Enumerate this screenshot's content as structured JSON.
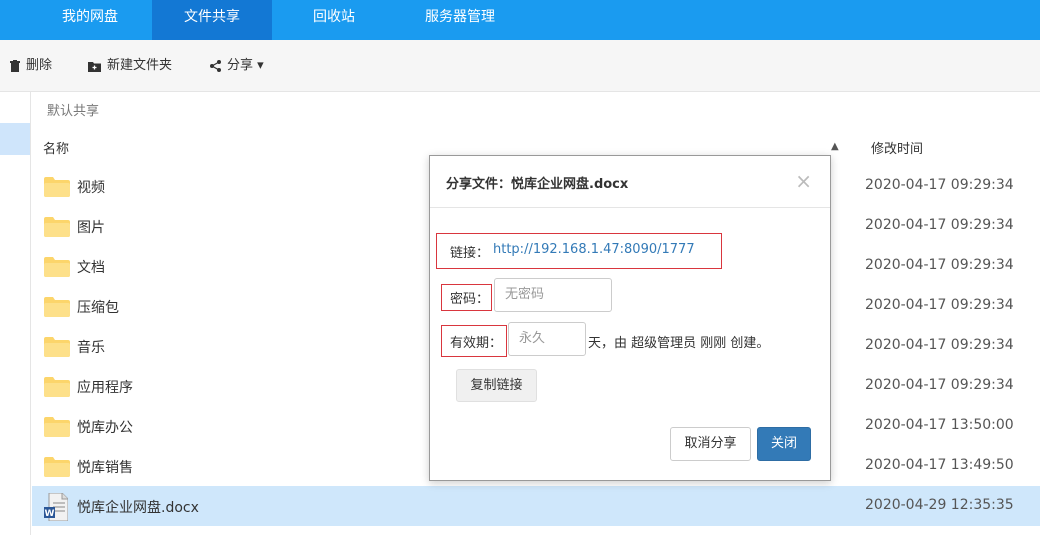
{
  "nav": {
    "tabs": [
      {
        "label": "我的网盘"
      },
      {
        "label": "文件共享"
      },
      {
        "label": "回收站"
      },
      {
        "label": "服务器管理"
      }
    ]
  },
  "toolbar": {
    "delete_label": "删除",
    "new_folder_label": "新建文件夹",
    "share_label": "分享 ▾"
  },
  "breadcrumb": "默认共享",
  "columns": {
    "name": "名称",
    "modified": "修改时间"
  },
  "files": [
    {
      "name": "视频",
      "time": "2020-04-17 09:29:34",
      "type": "folder"
    },
    {
      "name": "图片",
      "time": "2020-04-17 09:29:34",
      "type": "folder"
    },
    {
      "name": "文档",
      "time": "2020-04-17 09:29:34",
      "type": "folder"
    },
    {
      "name": "压缩包",
      "time": "2020-04-17 09:29:34",
      "type": "folder"
    },
    {
      "name": "音乐",
      "time": "2020-04-17 09:29:34",
      "type": "folder"
    },
    {
      "name": "应用程序",
      "time": "2020-04-17 09:29:34",
      "type": "folder"
    },
    {
      "name": "悦库办公",
      "time": "2020-04-17 13:50:00",
      "type": "folder"
    },
    {
      "name": "悦库销售",
      "time": "2020-04-17 13:49:50",
      "type": "folder"
    },
    {
      "name": "悦库企业网盘.docx",
      "time": "2020-04-29 12:35:35",
      "type": "docx",
      "selected": true
    }
  ],
  "dialog": {
    "title": "分享文件：悦库企业网盘.docx",
    "link_label": "链接：",
    "link_url": "http://192.168.1.47:8090/1777",
    "password_label": "密码：",
    "password_placeholder": "无密码",
    "expiry_label": "有效期：",
    "expiry_placeholder": "永久",
    "expiry_suffix": "天，由 超级管理员 刚刚 创建。",
    "copy_label": "复制链接",
    "cancel_share_label": "取消分享",
    "close_label": "关闭"
  },
  "colors": {
    "nav_bg": "#1a9bf0",
    "nav_active": "#1378d4",
    "primary": "#337ab7",
    "highlight": "#d9363e",
    "row_selected": "#cfe7fb"
  }
}
